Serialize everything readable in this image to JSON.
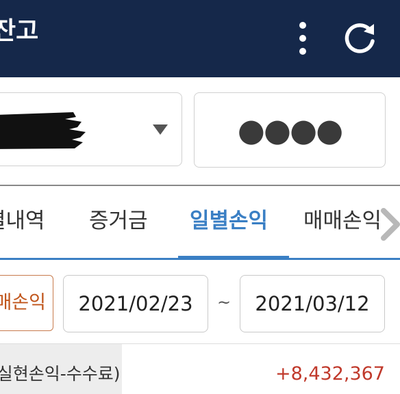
{
  "header": {
    "title": "잔고",
    "more_icon": "more-vertical-icon",
    "refresh_icon": "refresh-icon",
    "background_color": "#15284a"
  },
  "account": {
    "selected_account_redacted": true,
    "dropdown_icon": "caret-down-icon"
  },
  "password": {
    "masked_value": "●●●●"
  },
  "tabs": {
    "items": [
      {
        "label": "결내역",
        "active": false
      },
      {
        "label": "증거금",
        "active": false
      },
      {
        "label": "일별손익",
        "active": true
      },
      {
        "label": "매매손익",
        "active": false
      }
    ],
    "scroll_icon": "chevron-right-icon",
    "accent_color": "#3a7fc4"
  },
  "filter": {
    "type_label": "매매손익",
    "start_date": "2021/02/23",
    "separator": "~",
    "end_date": "2021/03/12"
  },
  "summary": {
    "label": "(실현손익-수수료)",
    "value": "+8,432,367",
    "value_color": "#c0392b"
  }
}
